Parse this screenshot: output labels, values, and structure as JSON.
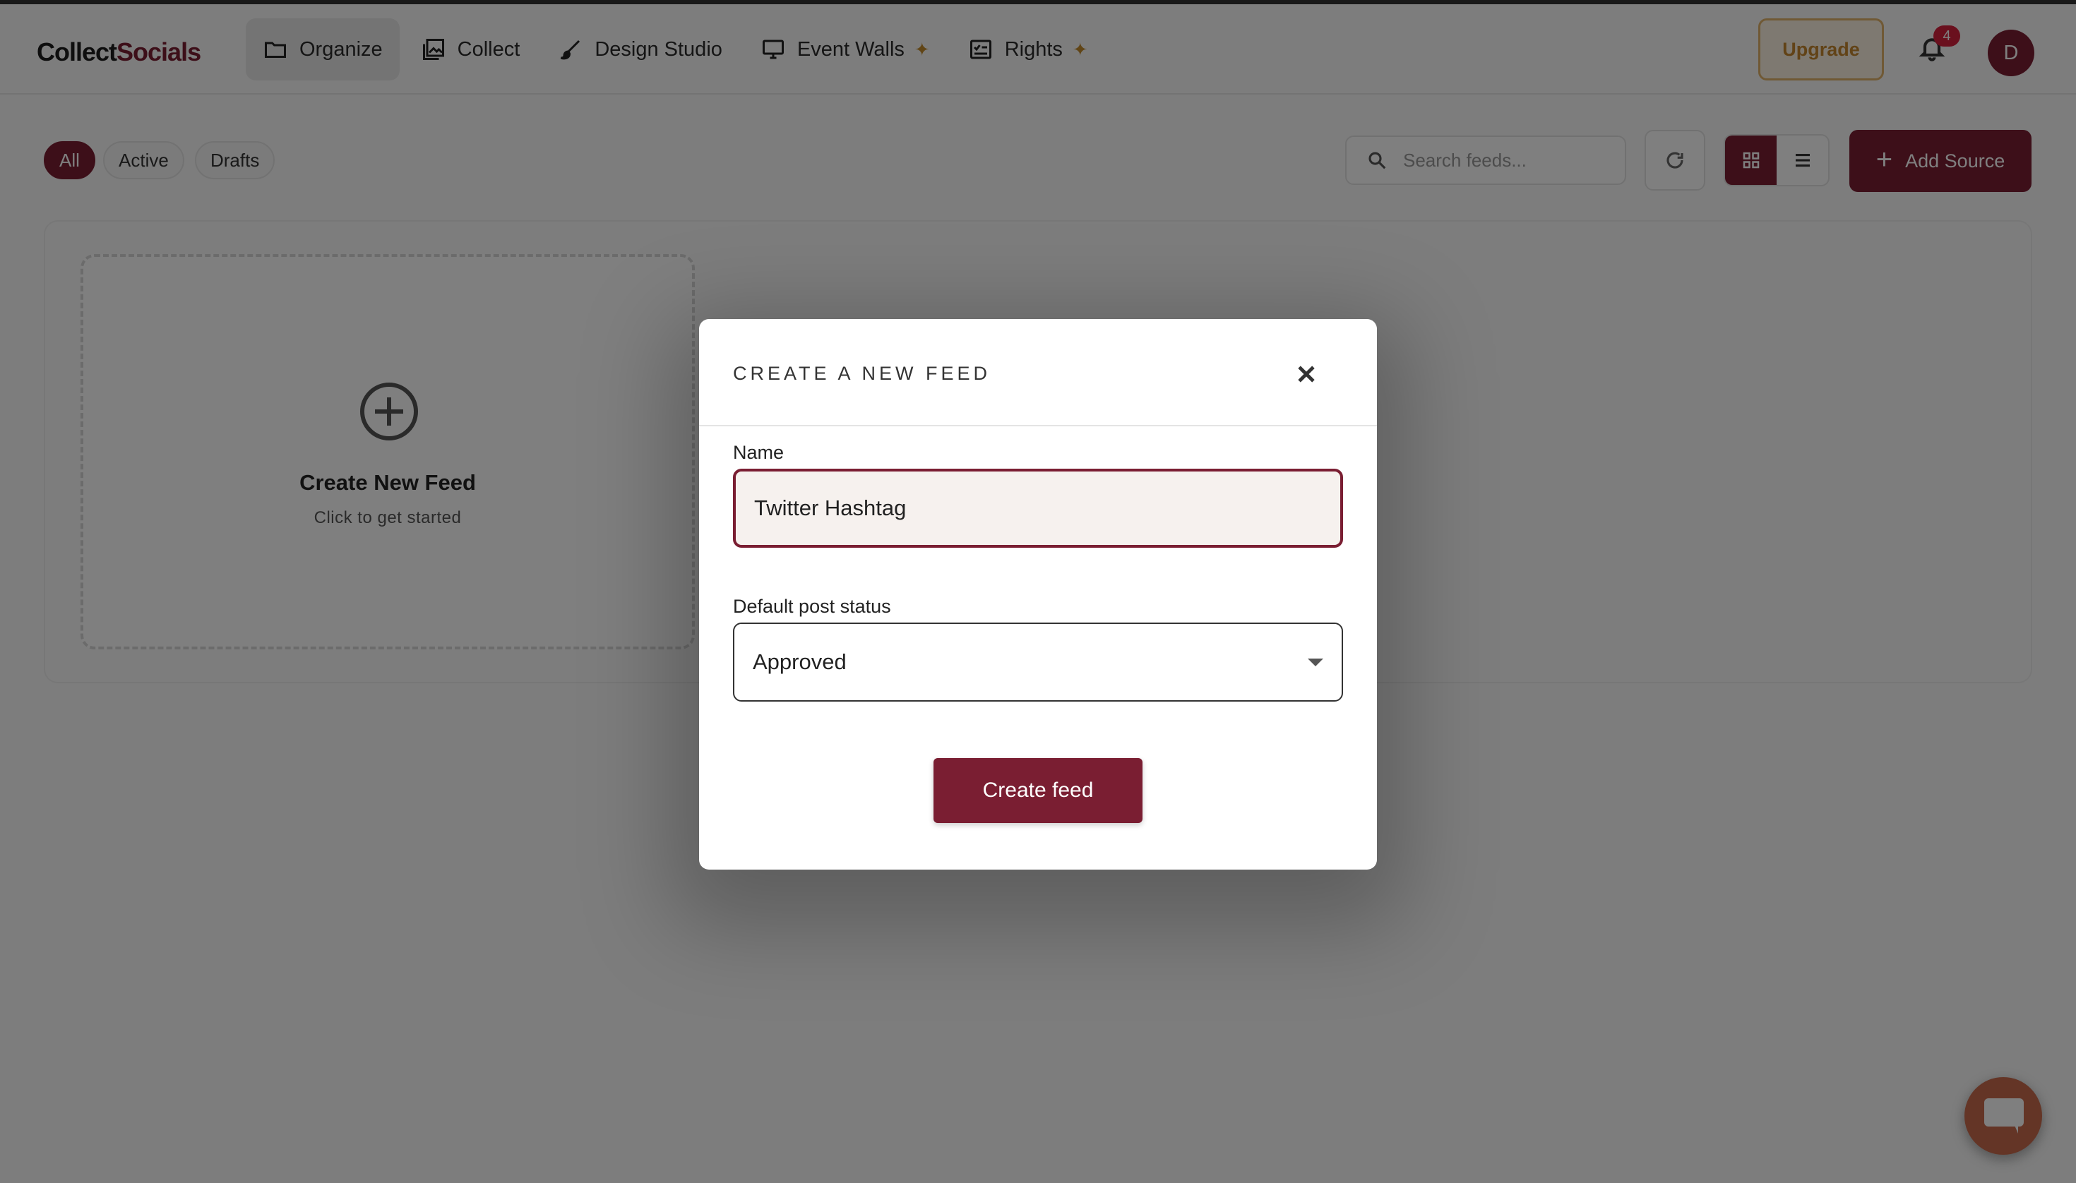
{
  "app": {
    "logo_text_main": "ollect",
    "logo_text_accent": "Socials",
    "logo_letter": "C"
  },
  "nav": {
    "items": [
      {
        "label": "Organize",
        "icon": "folder-icon",
        "active": true
      },
      {
        "label": "Collect",
        "icon": "gallery-icon",
        "active": false
      },
      {
        "label": "Design Studio",
        "icon": "brush-icon",
        "active": false
      },
      {
        "label": "Event Walls",
        "icon": "monitor-icon",
        "active": false,
        "badge_icon": "sparkle-icon"
      },
      {
        "label": "Rights",
        "icon": "rights-icon",
        "active": false,
        "badge_icon": "sparkle-icon"
      }
    ]
  },
  "header": {
    "upgrade_label": "Upgrade",
    "notification_count": "4",
    "avatar_initial": "D"
  },
  "filters": {
    "items": [
      "All",
      "Active",
      "Drafts"
    ],
    "selected": "All"
  },
  "toolbar": {
    "search_placeholder": "Search feeds...",
    "add_source_label": "Add Source",
    "view_mode": "grid"
  },
  "feed_card": {
    "title": "Create New Feed",
    "subtitle": "Click to get started"
  },
  "modal": {
    "title": "CREATE A NEW FEED",
    "name_label": "Name",
    "name_value": "Twitter Hashtag",
    "status_label": "Default post status",
    "status_value": "Approved",
    "submit_label": "Create feed"
  },
  "colors": {
    "brand": "#7a1e32",
    "upgrade_text": "#c4872f",
    "badge": "#d4213d",
    "chat": "#c86a4c"
  }
}
